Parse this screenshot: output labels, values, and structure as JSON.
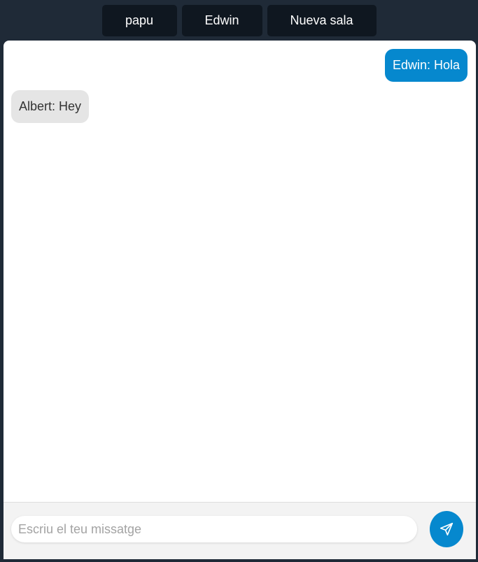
{
  "rooms": {
    "tabs": [
      {
        "label": "papu"
      },
      {
        "label": "Edwin"
      },
      {
        "label": "Nueva sala"
      }
    ]
  },
  "messages": [
    {
      "text": "Edwin: Hola",
      "own": true
    },
    {
      "text": "Albert: Hey",
      "own": false
    }
  ],
  "composer": {
    "placeholder": "Escriu el teu missatge",
    "value": "",
    "send_icon": "send-icon"
  },
  "colors": {
    "background": "#1f2a37",
    "tab": "#0f1720",
    "accent": "#0688ce",
    "other_bubble": "#e5e5e5"
  }
}
